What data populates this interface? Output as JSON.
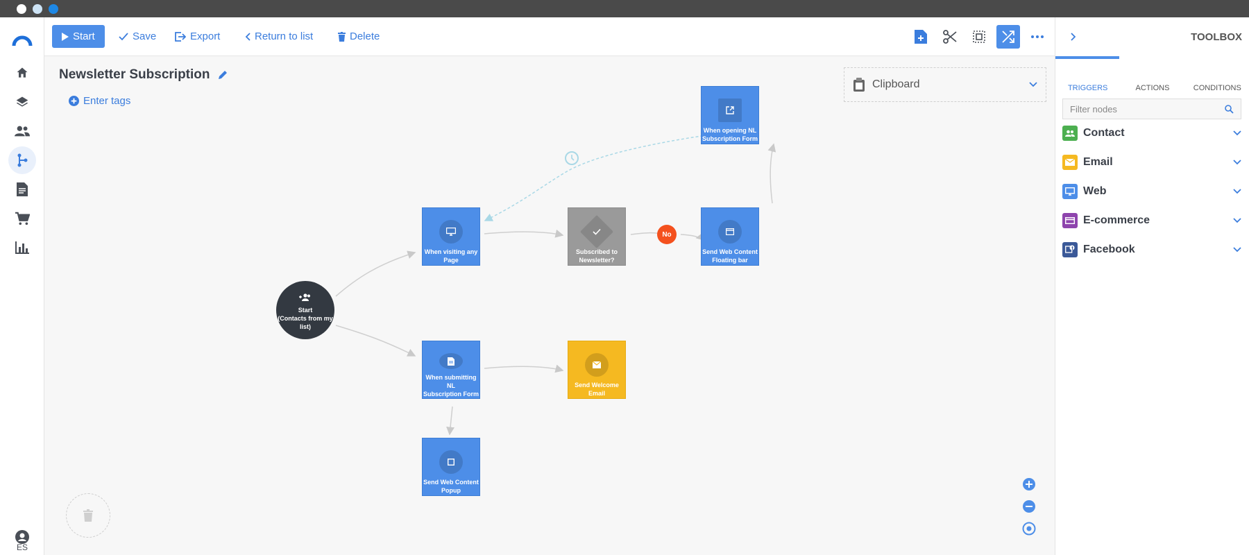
{
  "toolbar": {
    "start_label": "Start",
    "save_label": "Save",
    "export_label": "Export",
    "return_label": "Return to list",
    "delete_label": "Delete"
  },
  "flow": {
    "title": "Newsletter Subscription",
    "tags_label": "Enter tags"
  },
  "clipboard": {
    "label": "Clipboard"
  },
  "nodes": {
    "start": [
      "Start",
      "(Contacts from my",
      "list)"
    ],
    "visiting": [
      "When visiting any",
      "Page"
    ],
    "subscribed": [
      "Subscribed to",
      "Newsletter?"
    ],
    "floating": [
      "Send Web Content",
      "Floating bar"
    ],
    "opening": [
      "When opening NL",
      "Subscription Form"
    ],
    "submitting": [
      "When submitting NL",
      "Subscription Form"
    ],
    "welcome": [
      "Send Welcome Email"
    ],
    "popup": [
      "Send Web Content",
      "Popup"
    ]
  },
  "no_badge": "No",
  "leftnav": {
    "language": "ES"
  },
  "toolbox": {
    "title": "TOOLBOX",
    "tabs": [
      "TRIGGERS",
      "ACTIONS",
      "CONDITIONS"
    ],
    "filter_placeholder": "Filter nodes",
    "categories": [
      {
        "label": "Contact",
        "color": "#4caf50",
        "icon": "people-icon"
      },
      {
        "label": "Email",
        "color": "#f5b921",
        "icon": "envelope-icon"
      },
      {
        "label": "Web",
        "color": "#4d8ee8",
        "icon": "monitor-icon"
      },
      {
        "label": "E-commerce",
        "color": "#8e44ad",
        "icon": "card-icon"
      },
      {
        "label": "Facebook",
        "color": "#3b5998",
        "icon": "facebook-icon"
      }
    ]
  },
  "colors": {
    "accent": "#4d8ee8",
    "dark_node": "#333941",
    "condition_node": "#9a9a9a",
    "email_node": "#f5b921",
    "no_badge": "#f4511e"
  }
}
